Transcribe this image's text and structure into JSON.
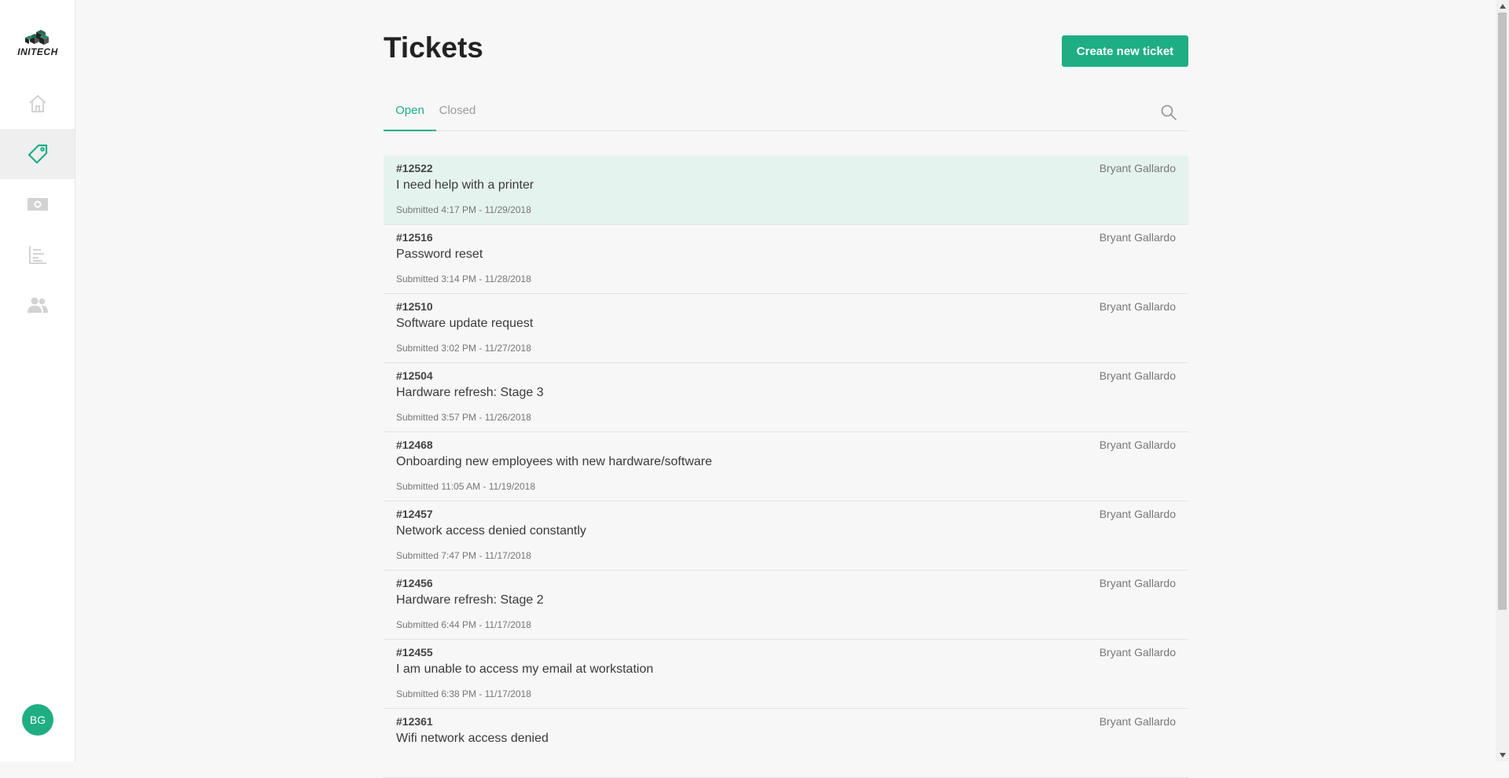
{
  "brand": {
    "logo_text": "INITECH"
  },
  "sidebar": {
    "items": [
      {
        "name": "home",
        "icon": "home-icon"
      },
      {
        "name": "tickets",
        "icon": "tag-icon",
        "active": true
      },
      {
        "name": "billing",
        "icon": "money-icon"
      },
      {
        "name": "reports",
        "icon": "bar-chart-icon"
      },
      {
        "name": "users",
        "icon": "people-icon"
      }
    ],
    "avatar_initials": "BG"
  },
  "header": {
    "title": "Tickets",
    "create_button_label": "Create new ticket"
  },
  "tabs": [
    {
      "label": "Open",
      "active": true
    },
    {
      "label": "Closed",
      "active": false
    }
  ],
  "tickets": [
    {
      "id": "#12522",
      "subject": "I need help with a printer",
      "submitted": "Submitted 4:17 PM - 11/29/2018",
      "assignee": "Bryant Gallardo"
    },
    {
      "id": "#12516",
      "subject": "Password reset",
      "submitted": "Submitted 3:14 PM - 11/28/2018",
      "assignee": "Bryant Gallardo"
    },
    {
      "id": "#12510",
      "subject": "Software update request",
      "submitted": "Submitted 3:02 PM - 11/27/2018",
      "assignee": "Bryant Gallardo"
    },
    {
      "id": "#12504",
      "subject": "Hardware refresh: Stage 3",
      "submitted": "Submitted 3:57 PM - 11/26/2018",
      "assignee": "Bryant Gallardo"
    },
    {
      "id": "#12468",
      "subject": "Onboarding new employees with new hardware/software",
      "submitted": "Submitted 11:05 AM - 11/19/2018",
      "assignee": "Bryant Gallardo"
    },
    {
      "id": "#12457",
      "subject": "Network access denied constantly",
      "submitted": "Submitted 7:47 PM - 11/17/2018",
      "assignee": "Bryant Gallardo"
    },
    {
      "id": "#12456",
      "subject": "Hardware refresh: Stage 2",
      "submitted": "Submitted 6:44 PM - 11/17/2018",
      "assignee": "Bryant Gallardo"
    },
    {
      "id": "#12455",
      "subject": "I am unable to access my email at workstation",
      "submitted": "Submitted 6:38 PM - 11/17/2018",
      "assignee": "Bryant Gallardo"
    },
    {
      "id": "#12361",
      "subject": "Wifi network access denied",
      "submitted": "",
      "assignee": "Bryant Gallardo"
    }
  ],
  "colors": {
    "accent": "#1fae84",
    "selected_row": "#e5f3ee",
    "background": "#f7f7f7"
  }
}
